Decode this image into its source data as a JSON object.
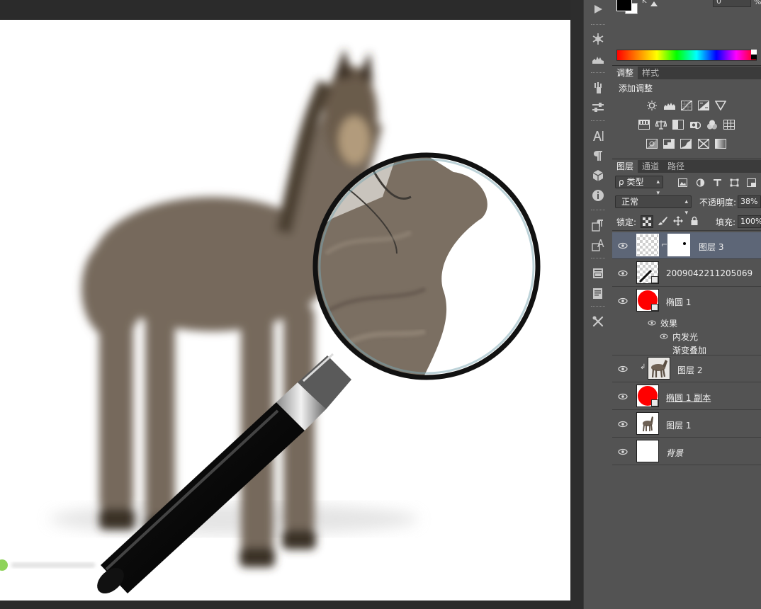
{
  "tool_strip": {
    "tools": [
      "play-icon",
      "snowflake-icon",
      "histogram-icon",
      "brushes-icon",
      "sliders-icon",
      "character-icon",
      "paragraph-icon",
      "cube-icon",
      "info-icon",
      "paragraph-style-icon",
      "character-style-icon",
      "notes-icon",
      "layer-comps-icon",
      "tool-presets-icon"
    ]
  },
  "color_panel": {
    "k_label": "K",
    "k_value": "0",
    "percent": "%",
    "foreground": "#000000",
    "background": "#ffffff"
  },
  "adjustments_panel": {
    "tabs": [
      "调整",
      "样式"
    ],
    "active_tab": 0,
    "title": "添加调整",
    "icons": [
      [
        "brightness-icon",
        "levels-icon",
        "curves-icon",
        "exposure-icon",
        "vibrance-icon"
      ],
      [
        "hue-saturation-icon",
        "color-balance-icon",
        "black-white-icon",
        "photo-filter-icon",
        "channel-mixer-icon",
        "color-lookup-icon"
      ],
      [
        "invert-icon",
        "posterize-icon",
        "threshold-icon",
        "selective-color-icon",
        "gradient-map-icon"
      ]
    ]
  },
  "layers_panel": {
    "tabs": [
      "图层",
      "通道",
      "路径"
    ],
    "active_tab": 0,
    "filter_type": "类型",
    "filter_search_glyph": "ρ",
    "filter_icons": [
      "pixel-filter-icon",
      "adjustment-filter-icon",
      "type-filter-icon",
      "shape-filter-icon",
      "smart-object-filter-icon"
    ],
    "blend_mode": "正常",
    "opacity_label": "不透明度:",
    "opacity_value": "38%",
    "lock_label": "锁定:",
    "lock_icons": [
      "lock-transparent-icon",
      "lock-paint-icon",
      "lock-move-icon",
      "lock-all-icon"
    ],
    "fill_label": "填充:",
    "fill_value": "100%",
    "layers": [
      {
        "name": "图层 3",
        "selected": true,
        "thumb": "checker",
        "has_mask": true
      },
      {
        "name": "2009042211205069",
        "selected": false,
        "thumb": "checker-smart"
      },
      {
        "name": "椭圆 1",
        "selected": false,
        "thumb": "red-circle"
      },
      {
        "name": "图层 2",
        "selected": false,
        "thumb": "donkey",
        "clipped": true
      },
      {
        "name": "椭圆 1 副本",
        "selected": false,
        "thumb": "red-circle",
        "underline": true
      },
      {
        "name": "图层 1",
        "selected": false,
        "thumb": "donkey-small"
      },
      {
        "name": "背景",
        "selected": false,
        "thumb": "white",
        "italic": true
      }
    ],
    "effects": {
      "label": "效果",
      "items": [
        "内发光",
        "渐变叠加"
      ]
    }
  },
  "colors": {
    "panel_bg": "#535353",
    "selected_row": "#5d6677",
    "accent_red": "#ff0000"
  }
}
